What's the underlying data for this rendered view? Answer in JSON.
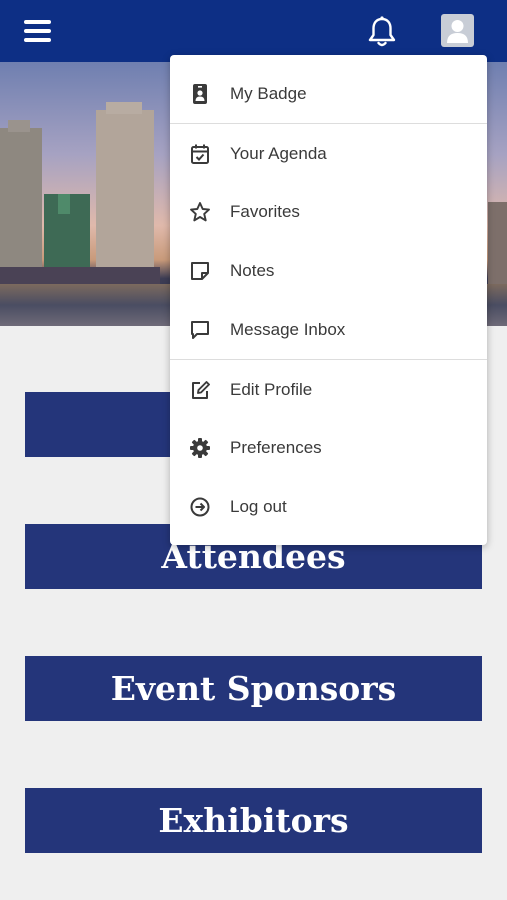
{
  "header": {
    "menu_icon": "hamburger-menu-icon",
    "notifications_icon": "bell-icon",
    "profile_icon": "user-avatar-icon"
  },
  "nav_buttons": [
    {
      "label": ""
    },
    {
      "label": "Attendees"
    },
    {
      "label": "Event Sponsors"
    },
    {
      "label": "Exhibitors"
    }
  ],
  "user_menu": {
    "items": [
      {
        "label": "My Badge",
        "icon": "badge-icon"
      },
      {
        "label": "Your Agenda",
        "icon": "calendar-check-icon"
      },
      {
        "label": "Favorites",
        "icon": "star-icon"
      },
      {
        "label": "Notes",
        "icon": "note-icon"
      },
      {
        "label": "Message Inbox",
        "icon": "chat-bubble-icon"
      },
      {
        "label": "Edit Profile",
        "icon": "edit-icon"
      },
      {
        "label": "Preferences",
        "icon": "gear-icon"
      },
      {
        "label": "Log out",
        "icon": "logout-icon"
      }
    ]
  },
  "colors": {
    "header": "#0d2f85",
    "nav_button": "#24357a",
    "page_background": "#efefef"
  }
}
